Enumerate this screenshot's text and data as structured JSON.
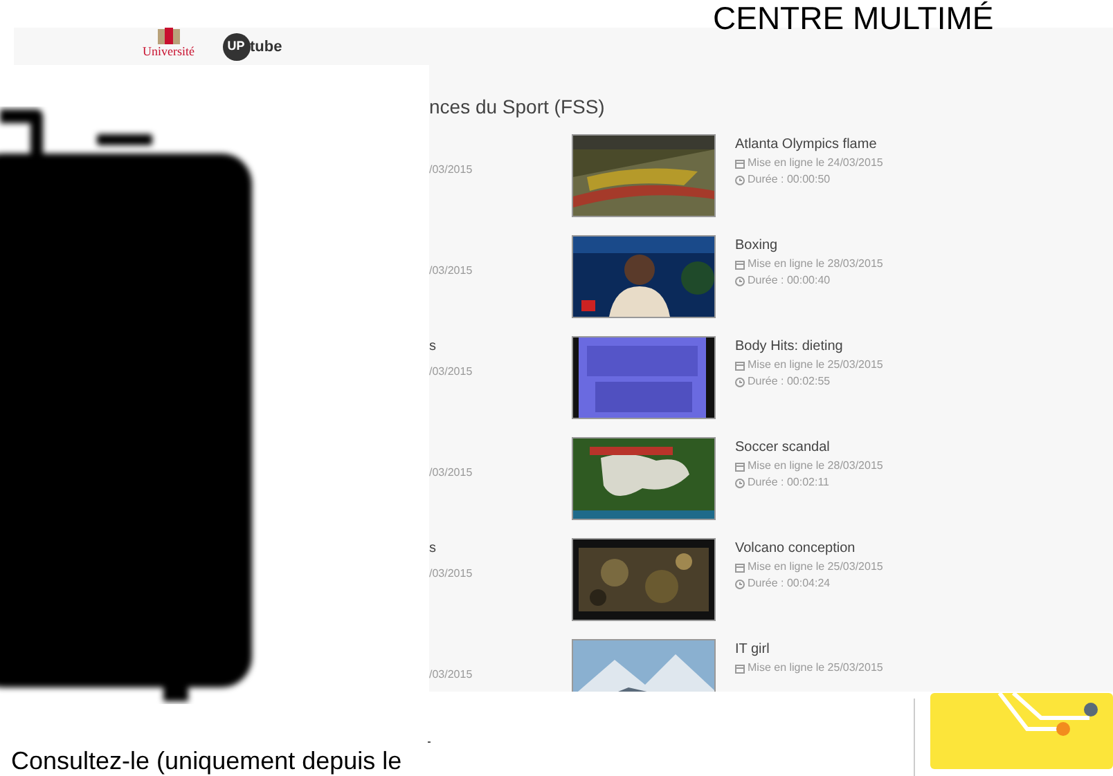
{
  "banner_title": "CENTRE MULTIMÉ",
  "logos": {
    "university": "Université",
    "tube_badge": "UP",
    "tube_word": "tube"
  },
  "heading": "nces du Sport (FSS)",
  "videos": [
    {
      "left_date": "/03/2015",
      "title": "Atlanta Olympics flame",
      "published": "Mise en ligne le 24/03/2015",
      "duration": "Durée : 00:00:50"
    },
    {
      "left_date": "/03/2015",
      "title": "Boxing",
      "published": "Mise en ligne le 28/03/2015",
      "duration": "Durée : 00:00:40"
    },
    {
      "left_text": "s",
      "left_date": "/03/2015",
      "title": "Body Hits: dieting",
      "published": "Mise en ligne le 25/03/2015",
      "duration": "Durée : 00:02:55"
    },
    {
      "left_date": "/03/2015",
      "title": "Soccer scandal",
      "published": "Mise en ligne le 28/03/2015",
      "duration": "Durée : 00:02:11"
    },
    {
      "left_text": "s",
      "left_date": "/03/2015",
      "title": "Volcano conception",
      "published": "Mise en ligne le 25/03/2015",
      "duration": "Durée : 00:04:24"
    },
    {
      "left_date": "/03/2015",
      "title": "IT girl",
      "published": "Mise en ligne le 25/03/2015"
    }
  ],
  "footer_text": "Consultez-le (uniquement depuis le"
}
